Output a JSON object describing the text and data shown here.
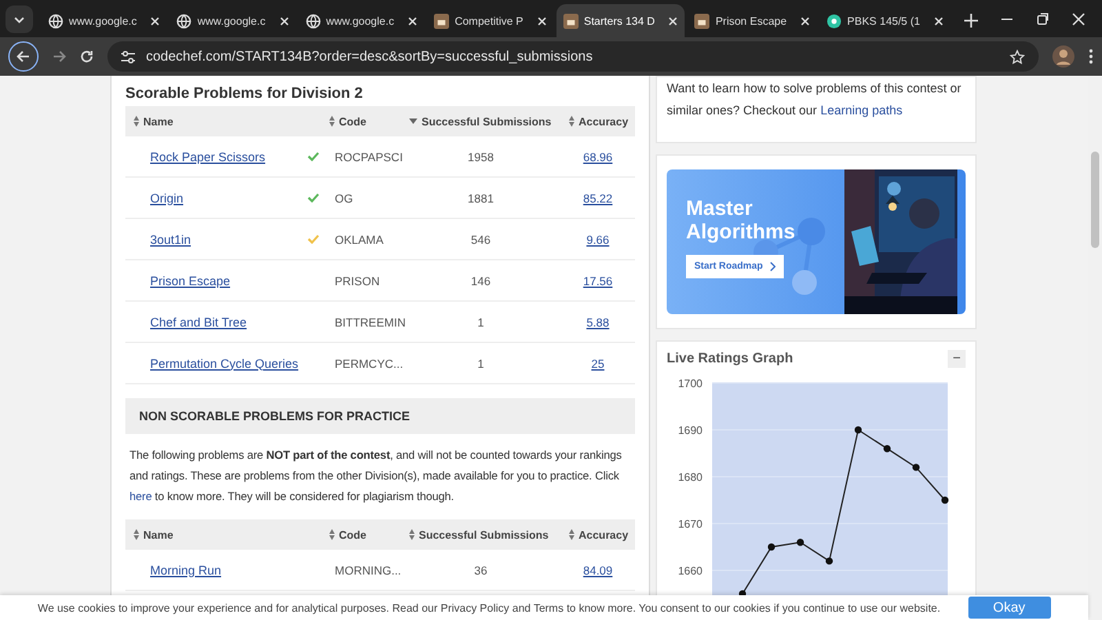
{
  "browser": {
    "tabs": [
      {
        "title": "www.google.c",
        "kind": "globe",
        "selected": false
      },
      {
        "title": "www.google.c",
        "kind": "globe",
        "selected": false
      },
      {
        "title": "www.google.c",
        "kind": "globe",
        "selected": false
      },
      {
        "title": "Competitive P",
        "kind": "chef",
        "selected": false
      },
      {
        "title": "Starters 134 D",
        "kind": "chef",
        "selected": true
      },
      {
        "title": "Prison Escape",
        "kind": "chef",
        "selected": false
      },
      {
        "title": "PBKS 145/5 (1",
        "kind": "ball",
        "selected": false
      }
    ],
    "address": "codechef.com/START134B?order=desc&sortBy=successful_submissions"
  },
  "scorable": {
    "title": "Scorable Problems for Division 2",
    "columns": [
      {
        "label": "Name",
        "kind": "sortable"
      },
      {
        "label": "Code",
        "kind": "sortable"
      },
      {
        "label": "Successful Submissions",
        "kind": "sorted"
      },
      {
        "label": "Accuracy",
        "kind": "sortable"
      }
    ],
    "rows": [
      {
        "name": "Rock Paper Scissors",
        "kind": "solved",
        "code": "ROCPAPSCI",
        "submissions": "1958",
        "accuracy": "68.96"
      },
      {
        "name": "Origin",
        "kind": "solved",
        "code": "OG",
        "submissions": "1881",
        "accuracy": "85.22"
      },
      {
        "name": "3out1in",
        "kind": "partial",
        "code": "OKLAMA",
        "submissions": "546",
        "accuracy": "9.66"
      },
      {
        "name": "Prison Escape",
        "kind": "unsolved",
        "code": "PRISON",
        "submissions": "146",
        "accuracy": "17.56"
      },
      {
        "name": "Chef and Bit Tree",
        "kind": "unsolved",
        "code": "BITTREEMIN",
        "submissions": "1",
        "accuracy": "5.88"
      },
      {
        "name": "Permutation Cycle Queries",
        "kind": "unsolved",
        "code": "PERMCYC...",
        "submissions": "1",
        "accuracy": "25"
      }
    ]
  },
  "practice": {
    "title": "NON SCORABLE PROBLEMS FOR PRACTICE",
    "note": "The following problems are **NOT part of the contest**, and will not be counted towards your rankings and ratings. These are problems from the other Division(s), made available for you to practice. Click ",
    "note_link": "here",
    "note_end": " to know more. They will be considered for plagiarism though.",
    "columns": [
      {
        "label": "Name",
        "kind": "sortable"
      },
      {
        "label": "Code",
        "kind": "sortable"
      },
      {
        "label": "Successful Submissions",
        "kind": "sortable"
      },
      {
        "label": "Accuracy",
        "kind": "sortable"
      }
    ],
    "rows": [
      {
        "name": "Morning Run",
        "code": "MORNING...",
        "submissions": "36",
        "accuracy": "84.09"
      }
    ]
  },
  "sidebar": {
    "learn_text": "Want to learn how to solve problems of this contest or similar ones? Checkout our ",
    "learn_link": "Learning paths",
    "banner": {
      "title": "Master Algorithms",
      "button": "Start Roadmap"
    },
    "ratings": {
      "title": "Live Ratings Graph",
      "collapse": "−",
      "chart_data": {
        "type": "line",
        "values": [
          1655,
          1665,
          1666,
          1662,
          1690,
          1686,
          1682,
          1675
        ],
        "yticks": [
          1660,
          1670,
          1680,
          1690,
          1700
        ],
        "ylim": [
          1650,
          1700
        ],
        "grid": true,
        "marker": true
      }
    }
  },
  "cookie": {
    "text": "We use cookies to improve your experience and for analytical purposes. Read our ",
    "link1": "Privacy Policy",
    "mid": " and ",
    "link2": "Terms",
    "end": " to know more. You consent to our cookies if you continue to use our website.",
    "button": "Okay"
  }
}
